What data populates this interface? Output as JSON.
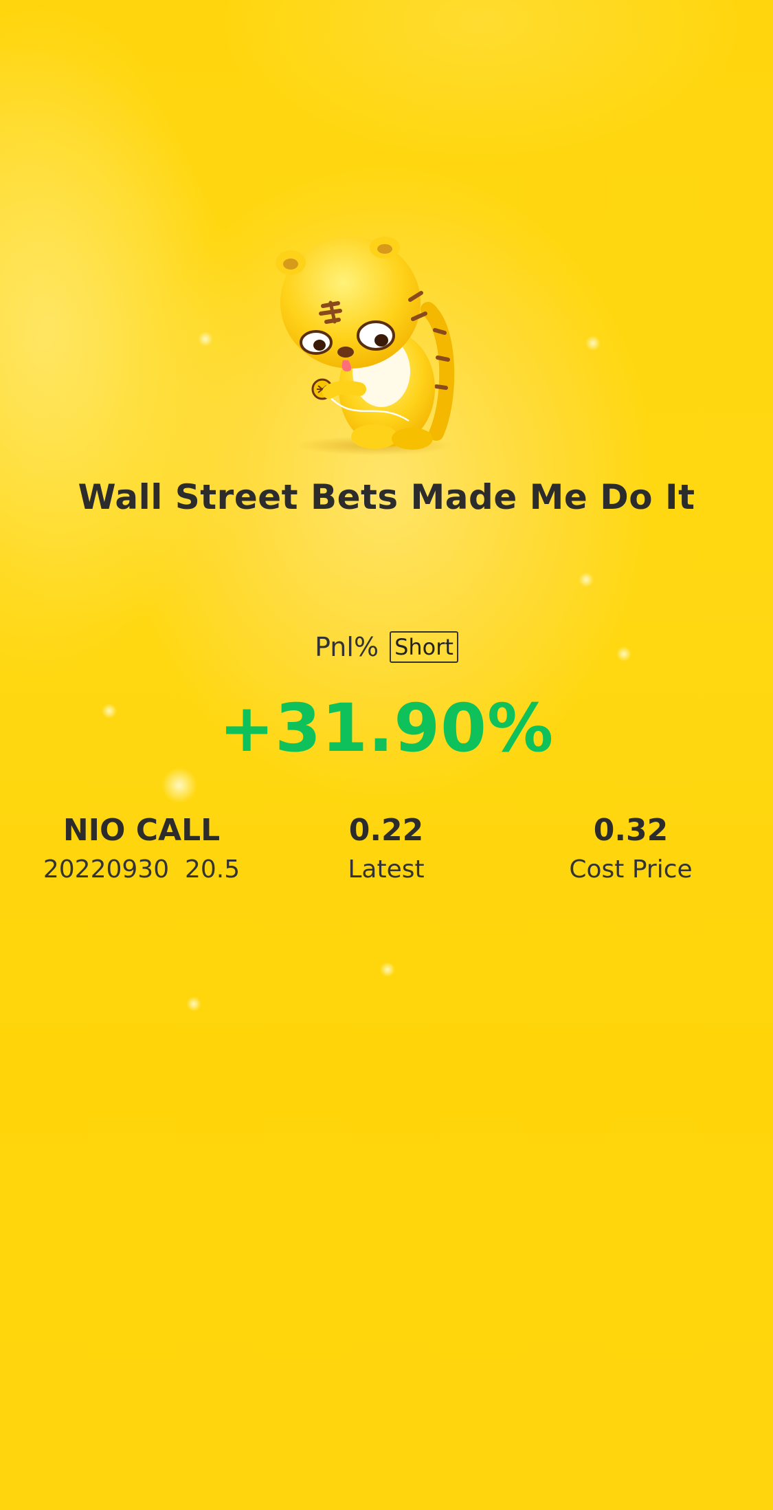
{
  "card": {
    "title": "Wall Street Bets Made Me Do It",
    "pnl_label": "Pnl%",
    "direction": "Short",
    "pnl_value": "+31.90%",
    "mascot": "tiger-mascot-icon"
  },
  "stats": [
    {
      "value": "NIO CALL",
      "label": "20220930  20.5"
    },
    {
      "value": "0.22",
      "label": "Latest"
    },
    {
      "value": "0.32",
      "label": "Cost Price"
    }
  ],
  "colors": {
    "background": "#ffd60e",
    "text": "#2c2c2c",
    "gain": "#0fc15b"
  }
}
